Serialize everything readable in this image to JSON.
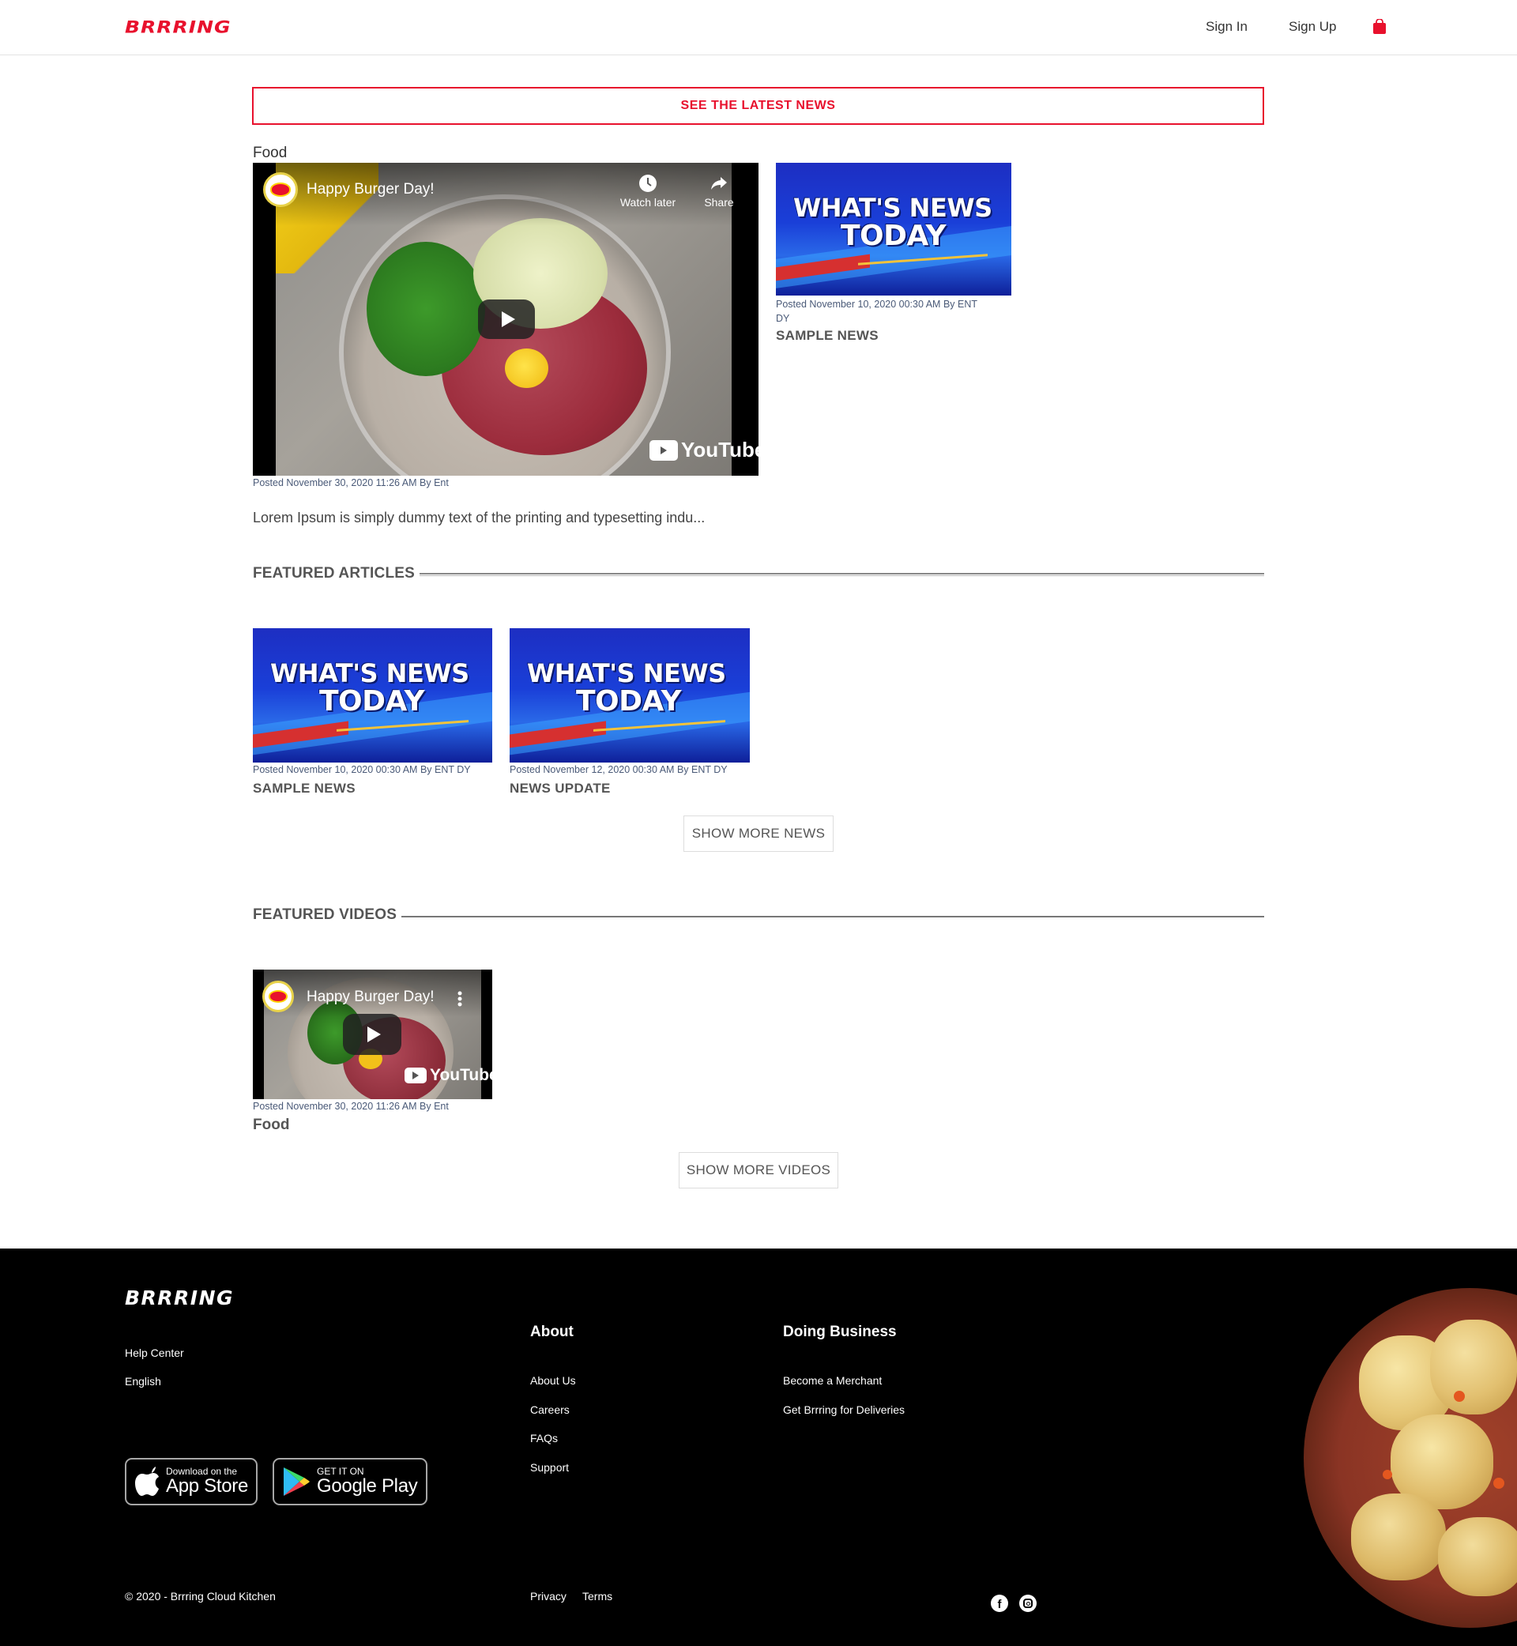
{
  "header": {
    "logo": "BRRRING",
    "sign_in": "Sign In",
    "sign_up": "Sign Up",
    "cart_icon": "shopping-bag-icon",
    "brand_color": "#e8112d"
  },
  "banner": {
    "latest_news": "SEE THE LATEST NEWS"
  },
  "main_feature": {
    "category": "Food",
    "video": {
      "title": "Happy Burger Day!",
      "watch_later": "Watch later",
      "share": "Share",
      "youtube": "YouTube"
    },
    "meta": "Posted November 30, 2020 11:26 AM By Ent",
    "excerpt": "Lorem Ipsum is simply dummy text of the printing and typesetting indu..."
  },
  "side_article": {
    "thumb_line1": "WHAT'S NEWS",
    "thumb_line2": "TODAY",
    "meta_line1": "Posted November 10, 2020 00:30 AM By ENT",
    "meta_line2": "DY",
    "title": "SAMPLE NEWS"
  },
  "featured_articles": {
    "heading": "FEATURED ARTICLES",
    "items": [
      {
        "thumb_line1": "WHAT'S NEWS",
        "thumb_line2": "TODAY",
        "meta": "Posted November 10, 2020 00:30 AM By ENT DY",
        "title": "SAMPLE NEWS"
      },
      {
        "thumb_line1": "WHAT'S NEWS",
        "thumb_line2": "TODAY",
        "meta": "Posted November 12, 2020 00:30 AM By ENT DY",
        "title": "NEWS UPDATE"
      }
    ],
    "more_button": "SHOW MORE NEWS"
  },
  "featured_videos": {
    "heading": "FEATURED VIDEOS",
    "items": [
      {
        "video_title": "Happy Burger Day!",
        "youtube": "YouTube",
        "meta": "Posted November 30, 2020 11:26 AM By Ent",
        "category": "Food"
      }
    ],
    "more_button": "SHOW MORE VIDEOS"
  },
  "footer": {
    "logo": "BRRRING",
    "help_center": "Help Center",
    "language": "English",
    "about": {
      "heading": "About",
      "links": [
        "About Us",
        "Careers",
        "FAQs",
        "Support"
      ]
    },
    "business": {
      "heading": "Doing Business",
      "links": [
        "Become a Merchant",
        "Get Brrring for Deliveries"
      ]
    },
    "app_store": {
      "small": "Download on the",
      "big": "App Store"
    },
    "google_play": {
      "small": "GET IT ON",
      "big": "Google Play"
    },
    "copyright": "© 2020 - Brrring Cloud Kitchen",
    "privacy": "Privacy",
    "terms": "Terms",
    "social_icons": [
      "facebook-icon",
      "instagram-icon"
    ]
  }
}
